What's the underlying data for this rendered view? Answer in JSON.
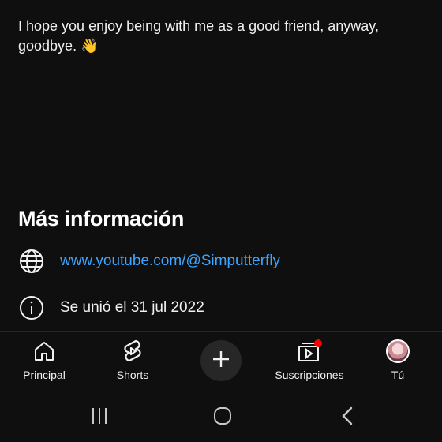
{
  "description": {
    "text": "I hope you enjoy being with me as a good friend, anyway, goodbye.",
    "emoji": "👋"
  },
  "more_info": {
    "title": "Más información",
    "link": "www.youtube.com/@Simputterfly",
    "joined": "Se unió el 31 jul 2022"
  },
  "bottom_nav": {
    "items": [
      {
        "label": "Principal",
        "icon": "home-icon"
      },
      {
        "label": "Shorts",
        "icon": "shorts-icon"
      },
      {
        "label": "",
        "icon": "create-plus-icon"
      },
      {
        "label": "Suscripciones",
        "icon": "subscriptions-icon"
      },
      {
        "label": "Tú",
        "icon": "avatar"
      }
    ],
    "notification_dot_color": "#ff0000"
  },
  "system_nav": {
    "buttons": [
      "recent-apps-icon",
      "home-circle-icon",
      "back-icon"
    ]
  },
  "colors": {
    "background": "#0f0f0f",
    "text": "#f1f1f1",
    "link": "#3ea6ff"
  }
}
